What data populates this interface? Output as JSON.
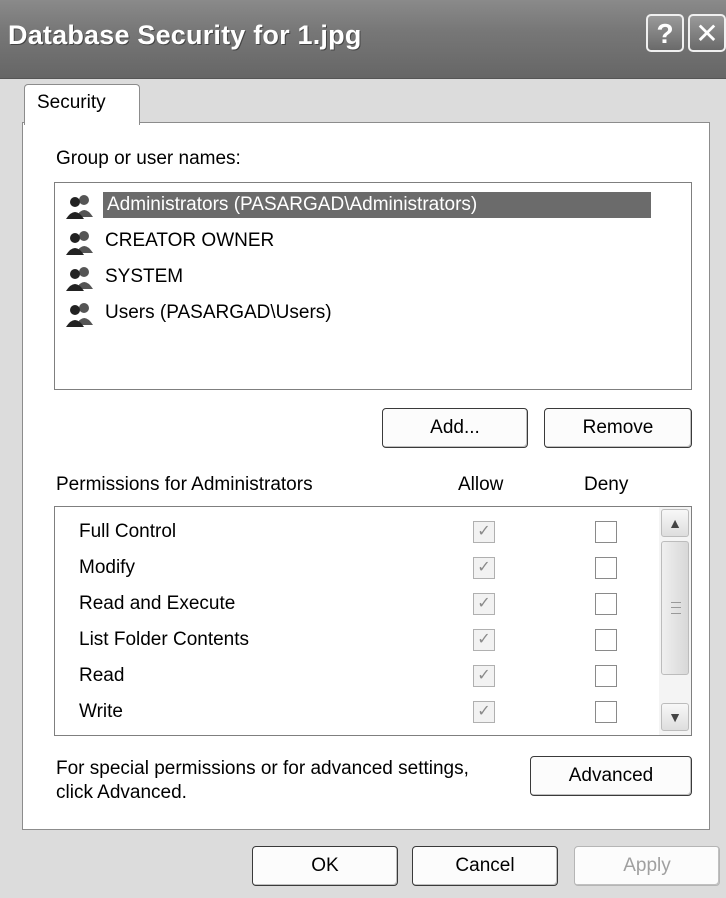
{
  "window": {
    "title": "Database Security for 1.jpg",
    "help_glyph": "?",
    "close_glyph": "✕"
  },
  "tabs": [
    {
      "label": "Security",
      "active": true
    }
  ],
  "groups": {
    "label": "Group or user names:",
    "items": [
      {
        "label": "Administrators (PASARGAD\\Administrators)",
        "selected": true,
        "icon": "users-group-icon"
      },
      {
        "label": "CREATOR OWNER",
        "selected": false,
        "icon": "users-group-icon"
      },
      {
        "label": "SYSTEM",
        "selected": false,
        "icon": "users-group-icon"
      },
      {
        "label": "Users (PASARGAD\\Users)",
        "selected": false,
        "icon": "users-group-icon"
      }
    ],
    "add_label": "Add...",
    "remove_label": "Remove"
  },
  "permissions": {
    "label": "Permissions for Administrators",
    "allow_header": "Allow",
    "deny_header": "Deny",
    "rows": [
      {
        "name": "Full Control",
        "allow": true,
        "deny": false
      },
      {
        "name": "Modify",
        "allow": true,
        "deny": false
      },
      {
        "name": "Read and Execute",
        "allow": true,
        "deny": false
      },
      {
        "name": "List Folder Contents",
        "allow": true,
        "deny": false
      },
      {
        "name": "Read",
        "allow": true,
        "deny": false
      },
      {
        "name": "Write",
        "allow": true,
        "deny": false
      }
    ]
  },
  "advanced": {
    "text_line1": "For special permissions or for advanced settings,",
    "text_line2": "click Advanced.",
    "button_label": "Advanced"
  },
  "footer": {
    "ok_label": "OK",
    "cancel_label": "Cancel",
    "apply_label": "Apply"
  },
  "scroll_icons": {
    "up": "▲",
    "down": "▼"
  }
}
